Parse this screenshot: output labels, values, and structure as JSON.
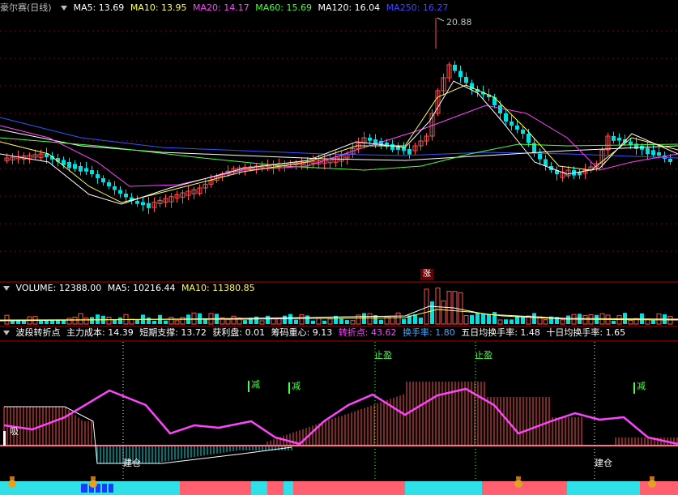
{
  "main_header": {
    "title": "豪尔赛(日线)",
    "ma": [
      {
        "label": "MA5: 13.69",
        "color": "#ffffff"
      },
      {
        "label": "MA10: 13.95",
        "color": "#ffff55"
      },
      {
        "label": "MA20: 14.17",
        "color": "#ff44ff"
      },
      {
        "label": "MA60: 15.69",
        "color": "#44ff44"
      },
      {
        "label": "MA120: 16.04",
        "color": "#ffffff"
      },
      {
        "label": "MA250: 16.27",
        "color": "#4444ff"
      }
    ]
  },
  "peak_label": "20.88",
  "zhang_badge": "涨",
  "volume_header": {
    "items": [
      {
        "label": "VOLUME: 12388.00",
        "color": "#ffffff"
      },
      {
        "label": "MA5: 10216.44",
        "color": "#ffffff"
      },
      {
        "label": "MA10: 11380.85",
        "color": "#ffff55"
      }
    ]
  },
  "indicator_header": {
    "items": [
      {
        "label": "波段转折点",
        "color": "#ffffff"
      },
      {
        "label": "主力成本: 14.39",
        "color": "#ffffff"
      },
      {
        "label": "短期支撑: 13.72",
        "color": "#ffffff"
      },
      {
        "label": "获利盘: 0.01",
        "color": "#ffffff"
      },
      {
        "label": "筹码重心: 9.13",
        "color": "#ffffff"
      },
      {
        "label": "转折点: 43.62",
        "color": "#ff44ff"
      },
      {
        "label": "换手率: 1.80",
        "color": "#44aaff"
      },
      {
        "label": "五日均换手率: 1.48",
        "color": "#ffffff"
      },
      {
        "label": "十日均换手率: 1.65",
        "color": "#ffffff"
      }
    ]
  },
  "signals": {
    "zhiying": "止盈",
    "jian": "减",
    "jiancang": "建仓",
    "xi": "吸"
  },
  "colors": {
    "up": "#ff5050",
    "down": "#00e0e0",
    "grid": "#7a0000",
    "magenta": "#ff44ff",
    "green": "#44ff44",
    "blue": "#3355ff"
  }
}
